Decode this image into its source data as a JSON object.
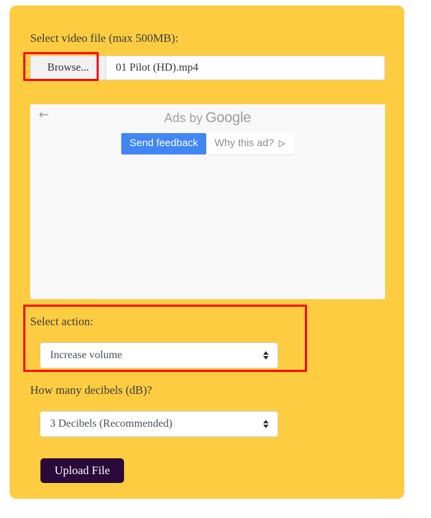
{
  "theme": {
    "card_background": "#fdcc41",
    "page_background": "#ffffff",
    "annotation_color": "#ff0000",
    "accent_blue": "#4285f4",
    "upload_button_color": "#2a0a3a"
  },
  "form": {
    "file_label": "Select video file (max 500MB):",
    "browse_label": "Browse...",
    "file_name": "01 Pilot (HD).mp4",
    "action_label": "Select action:",
    "action_value": "Increase volume",
    "decibel_label": "How many decibels (dB)?",
    "decibel_value": "3 Decibels (Recommended)",
    "upload_label": "Upload File"
  },
  "ad_panel": {
    "back_icon": "back-arrow-icon",
    "ads_by_text": "Ads by",
    "google_text": "Google",
    "send_feedback_label": "Send feedback",
    "why_this_ad_label": "Why this ad?",
    "why_this_ad_icon": "play-outline-icon"
  }
}
